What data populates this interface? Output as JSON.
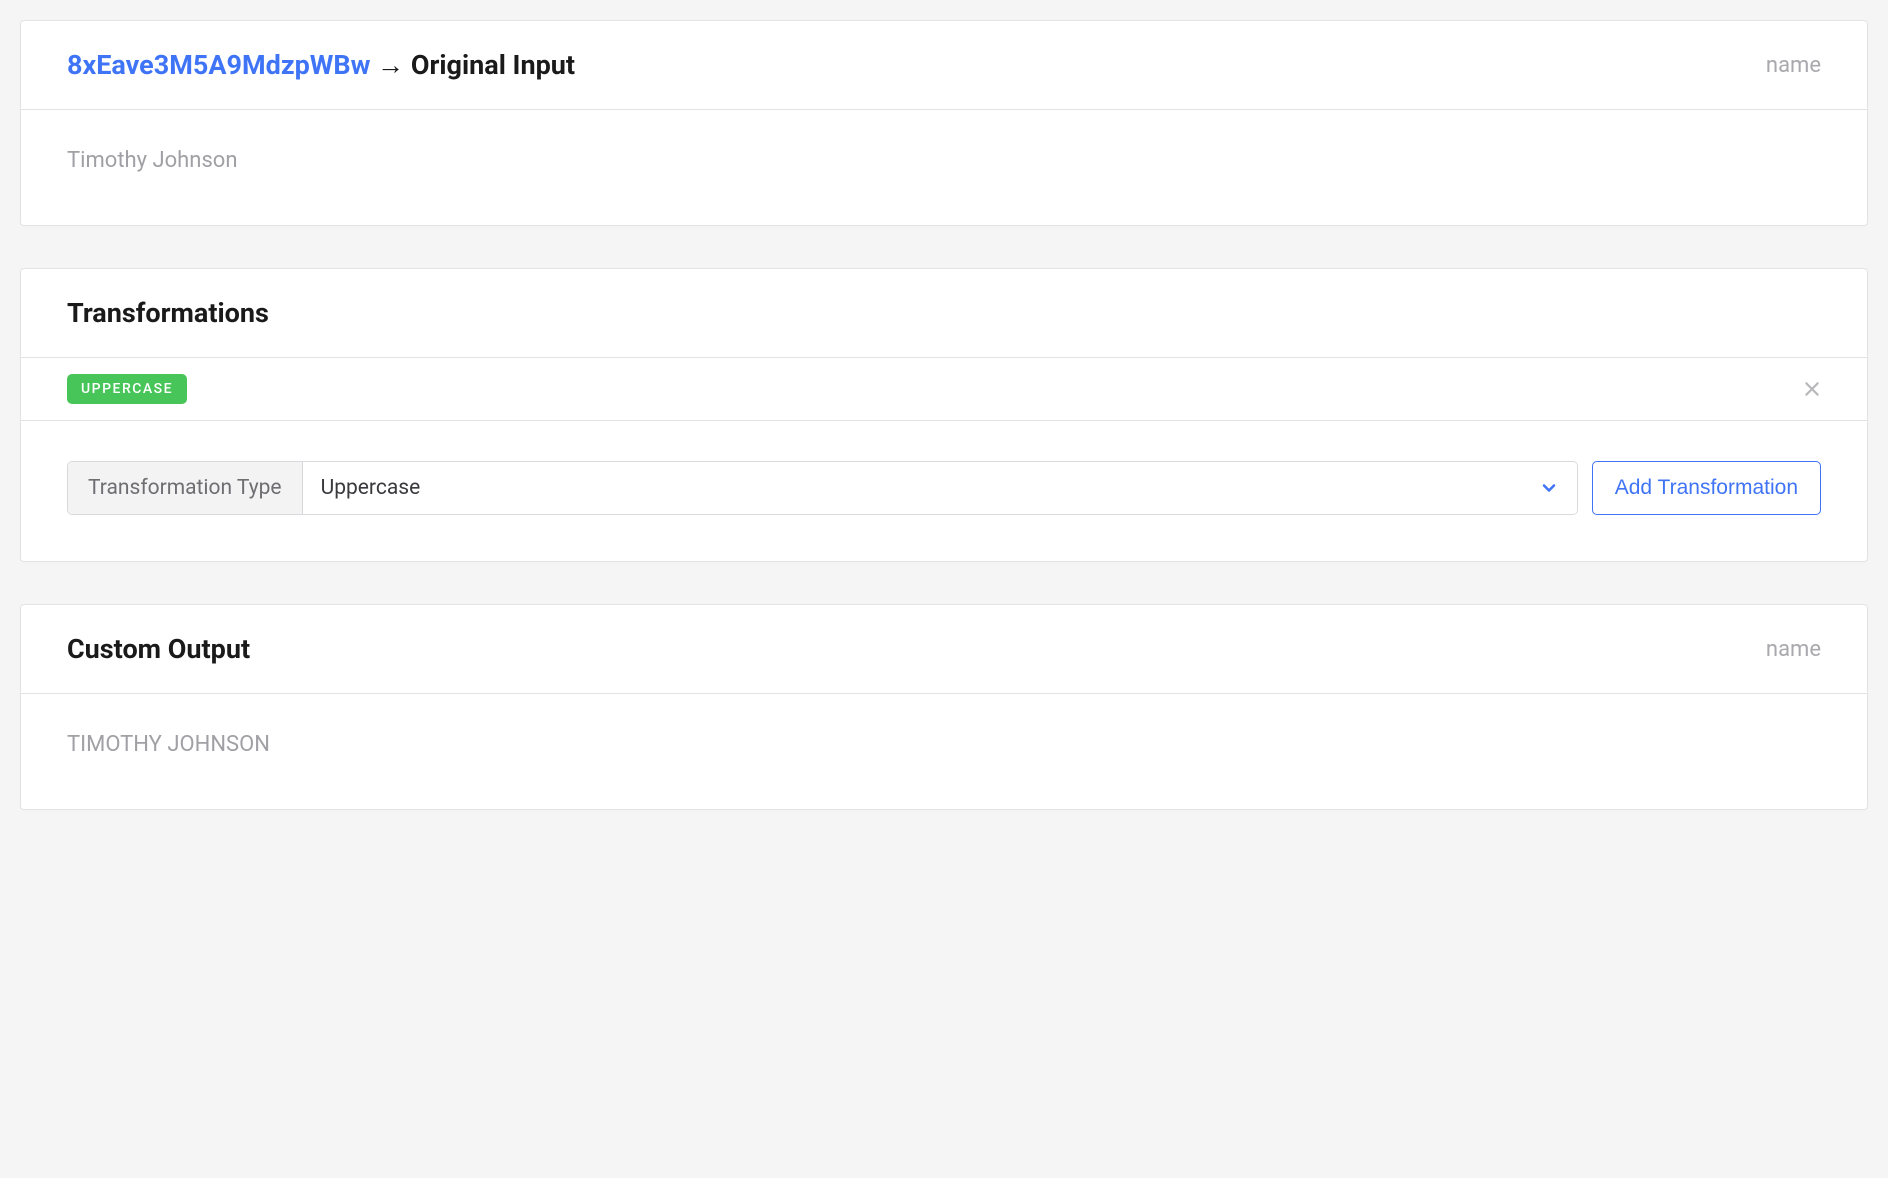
{
  "input_card": {
    "id_link": "8xEave3M5A9MdzpWBw",
    "arrow": "→",
    "title_suffix": "Original Input",
    "field_name": "name",
    "value": "Timothy Johnson"
  },
  "transformations": {
    "section_title": "Transformations",
    "applied": {
      "badge_label": "UPPERCASE"
    },
    "form": {
      "type_label": "Transformation Type",
      "selected_value": "Uppercase",
      "add_button_label": "Add Transformation"
    }
  },
  "output_card": {
    "title": "Custom Output",
    "field_name": "name",
    "value": "TIMOTHY JOHNSON"
  }
}
